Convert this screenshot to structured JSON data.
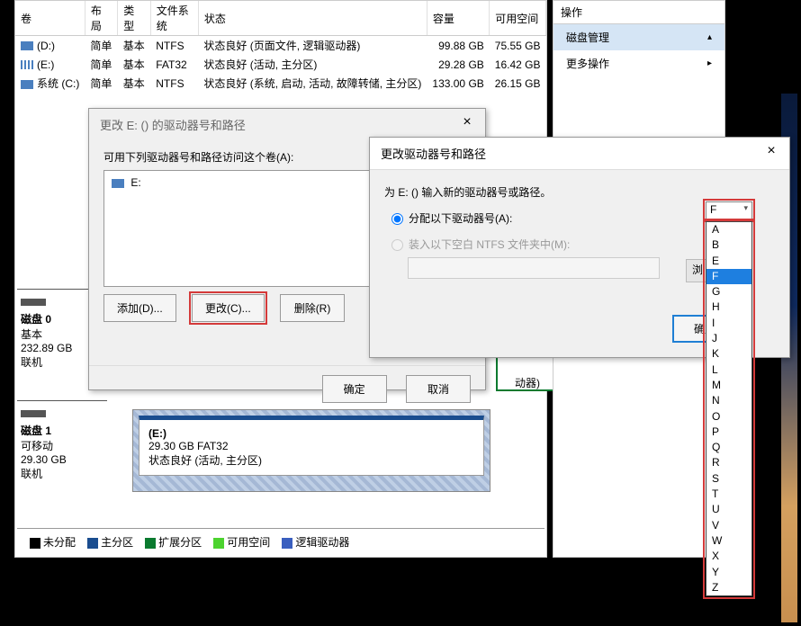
{
  "columns": {
    "vol": "卷",
    "layout": "布局",
    "type": "类型",
    "fs": "文件系统",
    "status": "状态",
    "capacity": "容量",
    "free": "可用空间"
  },
  "vols": [
    {
      "name": "(D:)",
      "layout": "简单",
      "type": "基本",
      "fs": "NTFS",
      "status": "状态良好 (页面文件, 逻辑驱动器)",
      "cap": "99.88 GB",
      "free": "75.55 GB"
    },
    {
      "name": "(E:)",
      "layout": "简单",
      "type": "基本",
      "fs": "FAT32",
      "status": "状态良好 (活动, 主分区)",
      "cap": "29.28 GB",
      "free": "16.42 GB"
    },
    {
      "name": "系统 (C:)",
      "layout": "简单",
      "type": "基本",
      "fs": "NTFS",
      "status": "状态良好 (系统, 启动, 活动, 故障转储, 主分区)",
      "cap": "133.00 GB",
      "free": "26.15 GB"
    }
  ],
  "actions": {
    "header": "操作",
    "item1": "磁盘管理",
    "item2": "更多操作"
  },
  "disk0": {
    "title": "磁盘 0",
    "type": "基本",
    "size": "232.89 GB",
    "state": "联机"
  },
  "disk1": {
    "title": "磁盘 1",
    "type": "可移动",
    "size": "29.30 GB",
    "state": "联机"
  },
  "partE": {
    "name": "(E:)",
    "line2": "29.30 GB FAT32",
    "line3": "状态良好 (活动, 主分区)"
  },
  "greenChunk": "动器)",
  "legend": {
    "unalloc": "未分配",
    "primary": "主分区",
    "ext": "扩展分区",
    "free": "可用空间",
    "logical": "逻辑驱动器"
  },
  "dlg1": {
    "title": "更改 E: () 的驱动器号和路径",
    "prompt": "可用下列驱动器号和路径访问这个卷(A):",
    "entry": "E:",
    "add": "添加(D)...",
    "change": "更改(C)...",
    "remove": "删除(R)",
    "ok": "确定",
    "cancel": "取消"
  },
  "dlg2": {
    "title": "更改驱动器号和路径",
    "prompt": "为 E: () 输入新的驱动器号或路径。",
    "opt1": "分配以下驱动器号(A):",
    "opt2": "装入以下空白 NTFS 文件夹中(M):",
    "browse": "浏",
    "ok": "确定"
  },
  "combo": {
    "selected": "F",
    "options": [
      "A",
      "B",
      "E",
      "F",
      "G",
      "H",
      "I",
      "J",
      "K",
      "L",
      "M",
      "N",
      "O",
      "P",
      "Q",
      "R",
      "S",
      "T",
      "U",
      "V",
      "W",
      "X",
      "Y",
      "Z"
    ]
  }
}
